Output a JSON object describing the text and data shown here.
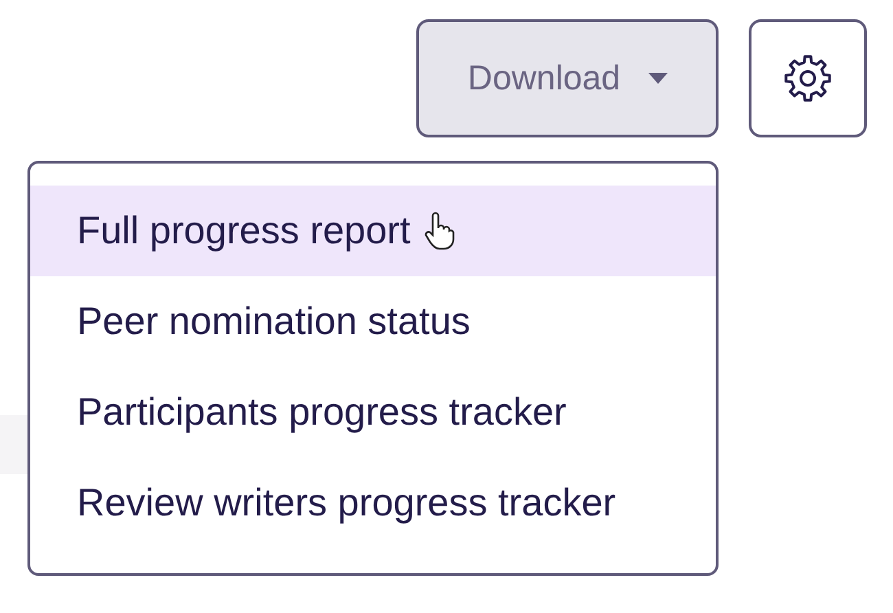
{
  "download_button": {
    "label": "Download"
  },
  "menu": {
    "items": [
      {
        "label": "Full progress report",
        "selected": true
      },
      {
        "label": "Peer nomination status",
        "selected": false
      },
      {
        "label": "Participants progress tracker",
        "selected": false
      },
      {
        "label": "Review writers progress tracker",
        "selected": false
      }
    ]
  }
}
